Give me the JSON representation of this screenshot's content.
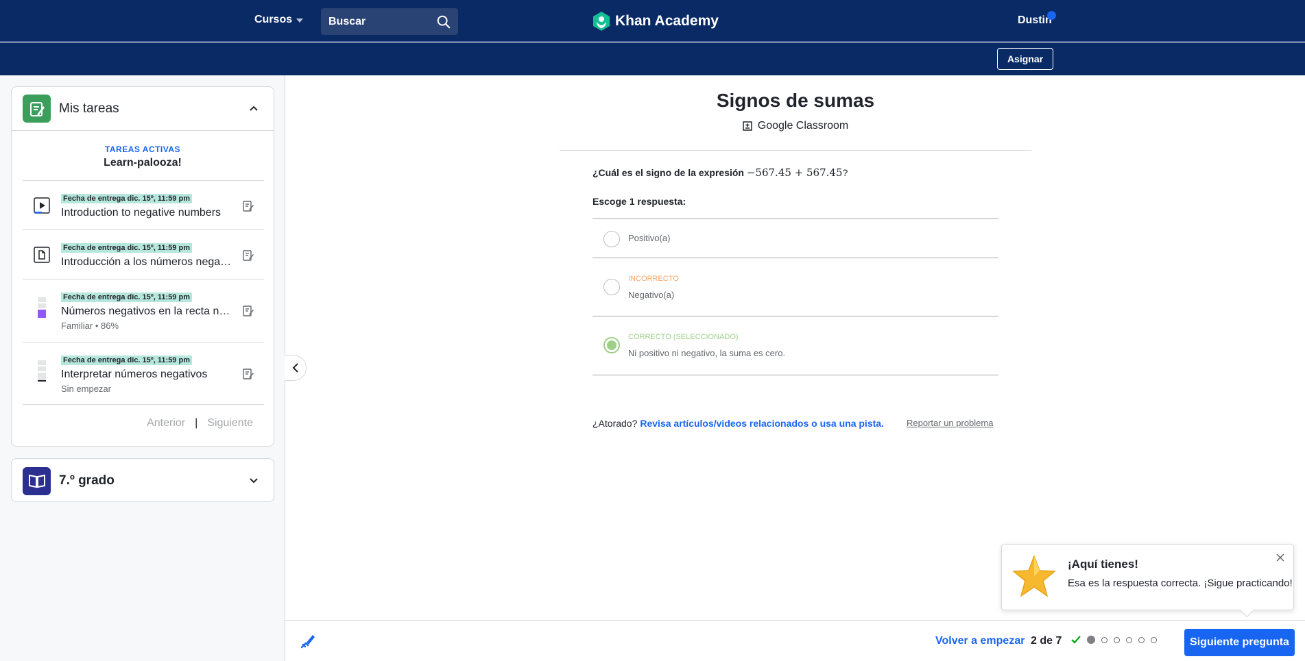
{
  "header": {
    "courses_label": "Cursos",
    "search_placeholder": "Buscar",
    "logo_text": "Khan Academy",
    "user_name": "Dustin",
    "assign_label": "Asignar"
  },
  "sidebar": {
    "my_tasks": {
      "title": "Mis tareas",
      "active_label": "TAREAS ACTIVAS",
      "active_name": "Learn-palooza!",
      "tasks": [
        {
          "due": "Fecha de entrega dic. 15º, 11:59 pm",
          "title": "Introduction to negative numbers",
          "sub": "",
          "icon": "video-icon"
        },
        {
          "due": "Fecha de entrega dic. 15º, 11:59 pm",
          "title": "Introducción a los números negativos",
          "sub": "",
          "icon": "article-icon"
        },
        {
          "due": "Fecha de entrega dic. 15º, 11:59 pm",
          "title": "Números negativos en la recta numérica",
          "sub": "Familiar • 86%",
          "icon": "mastery-familiar-icon"
        },
        {
          "due": "Fecha de entrega dic. 15º, 11:59 pm",
          "title": "Interpretar números negativos",
          "sub": "Sin empezar",
          "icon": "mastery-not-started-icon"
        }
      ],
      "prev_label": "Anterior",
      "separator": "|",
      "next_label": "Siguiente"
    },
    "course": {
      "title": "7.º grado"
    }
  },
  "exercise": {
    "title": "Signos de sumas",
    "classroom_label": "Google Classroom",
    "question_prefix": "¿Cuál es el signo de la expresión",
    "question_expression": "−567.45 + 567.45",
    "question_suffix": "?",
    "choose_label": "Escoge 1 respuesta:",
    "choices": [
      {
        "tag": "",
        "text": "Positivo(a)",
        "state": "none"
      },
      {
        "tag": "INCORRECTO",
        "text": "Negativo(a)",
        "state": "incorrect"
      },
      {
        "tag": "CORRECTO (SELECCIONADO)",
        "text": "Ni positivo ni negativo, la suma es cero.",
        "state": "correct"
      }
    ],
    "stuck_label": "¿Atorado?",
    "help_link": "Revisa artículos/videos relacionados o usa una pista.",
    "report_link": "Reportar un problema"
  },
  "toast": {
    "title": "¡Aquí tienes!",
    "message": "Esa es la respuesta correcta. ¡Sigue practicando!"
  },
  "footer": {
    "restart_label": "Volver a empezar",
    "progress_text": "2 de 7",
    "progress_current": 2,
    "progress_total": 7,
    "next_label": "Siguiente pregunta"
  },
  "colors": {
    "nav_bg": "#0a2a66",
    "accent_blue": "#1865f2",
    "correct_green": "#9cd086",
    "incorrect_orange": "#f9a56a",
    "due_badge_bg": "#b6e7dc",
    "mastery_purple": "#9059ff"
  }
}
